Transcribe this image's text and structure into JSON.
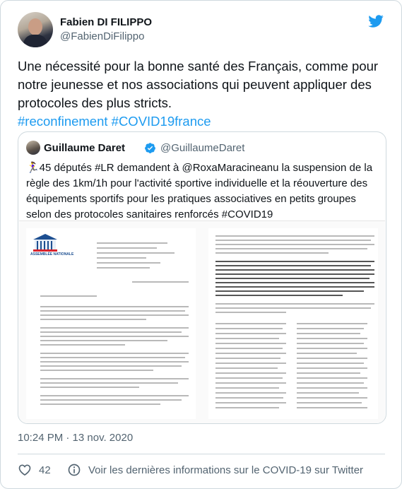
{
  "tweet": {
    "author_name": "Fabien DI FILIPPO",
    "author_handle": "@FabienDiFilippo",
    "text": "Une nécessité pour la bonne santé des Français, comme pour notre jeunesse et nos associations qui peuvent appliquer des protocoles des plus stricts.",
    "hashtags": "#reconfinement #COVID19france",
    "timestamp": "10:24 PM · 13 nov. 2020",
    "like_count": "42",
    "covid_info_link": "Voir les dernières informations sur le COVID-19 sur Twitter"
  },
  "quoted": {
    "author_name": "Guillaume Daret",
    "author_handle": "@GuillaumeDaret",
    "text": "🏃‍♀️45 députés #LR demandent à @RoxaMaracineanu la suspension de la règle des 1km/1h pour l'activité sportive individuelle et la réouverture des équipements sportifs pour les pratiques associatives en petits groupes selon des protocoles sanitaires renforcés #COVID19",
    "document_logo_text": "ASSEMBLÉE NATIONALE"
  },
  "colors": {
    "accent": "#1d9bf0",
    "text": "#0f1419",
    "muted": "#536471",
    "border": "#cfd9de"
  },
  "icons": [
    "twitter-bird-icon",
    "verified-badge-icon",
    "heart-icon",
    "info-icon"
  ]
}
